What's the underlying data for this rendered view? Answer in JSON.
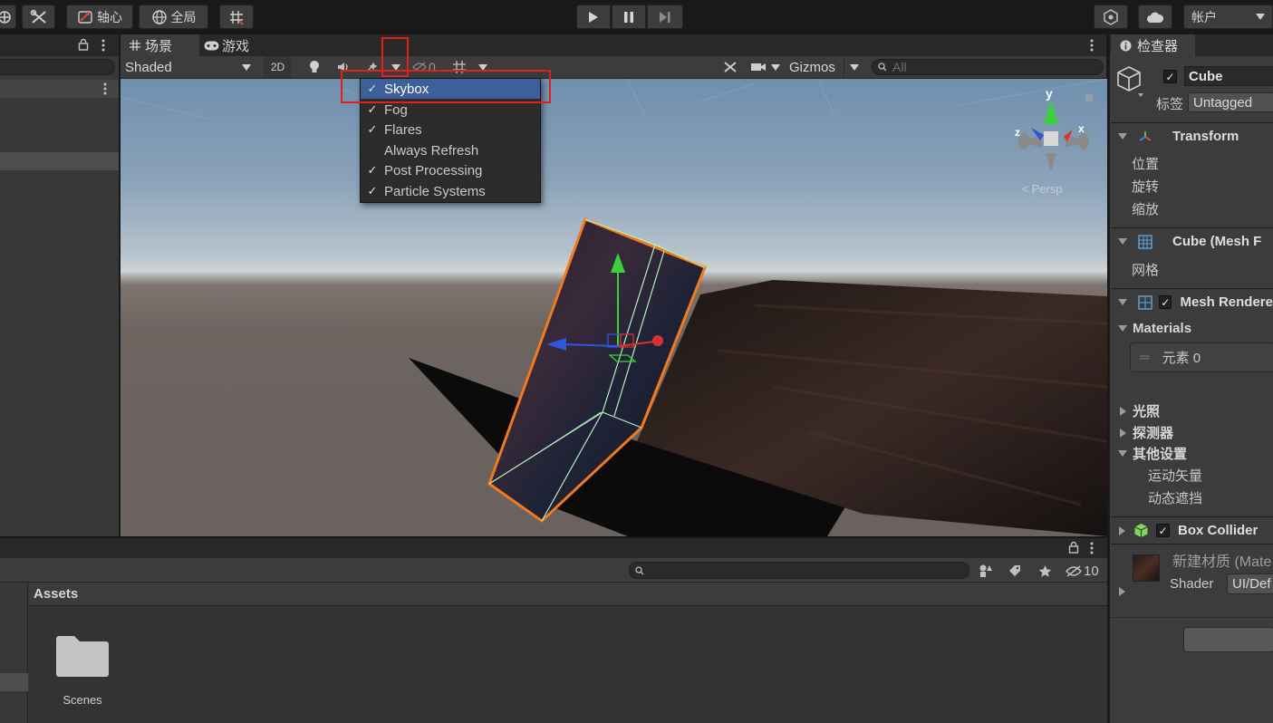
{
  "toolbar": {
    "pivot_label": "轴心",
    "global_label": "全局",
    "account_label": "帐户"
  },
  "scene_tabs": [
    {
      "label": "场景",
      "icon": "grid-icon"
    },
    {
      "label": "游戏",
      "icon": "gamepad-icon"
    }
  ],
  "scene_toolbar": {
    "shading_mode": "Shaded",
    "toggle_2d": "2D",
    "hidden_count": "0",
    "gizmos_label": "Gizmos",
    "search_placeholder": "All"
  },
  "effects_menu": {
    "items": [
      {
        "label": "Skybox",
        "checked": true,
        "highlighted": true
      },
      {
        "label": "Fog",
        "checked": true
      },
      {
        "label": "Flares",
        "checked": true
      },
      {
        "label": "Always Refresh",
        "checked": false
      },
      {
        "label": "Post Processing",
        "checked": true
      },
      {
        "label": "Particle Systems",
        "checked": true
      }
    ]
  },
  "scene_gizmo": {
    "y_axis": "y",
    "x_axis": "x",
    "z_axis": "z",
    "persp_label": "Persp"
  },
  "project": {
    "assets_header": "Assets",
    "hidden_count": "10",
    "folders": [
      {
        "name": "Scenes"
      }
    ]
  },
  "inspector": {
    "tab_label": "检查器",
    "object_name": "Cube",
    "tag_label": "标签",
    "tag_value": "Untagged",
    "transform": {
      "title": "Transform",
      "rows": [
        "位置",
        "旋转",
        "缩放"
      ]
    },
    "mesh_filter": {
      "title": "Cube (Mesh F",
      "mesh_label": "网格"
    },
    "mesh_renderer": {
      "title": "Mesh Rendere",
      "materials_label": "Materials",
      "element_label": "元素 0",
      "sections": [
        "光照",
        "探测器",
        "其他设置"
      ],
      "other_rows": [
        "运动矢量",
        "动态遮挡"
      ]
    },
    "box_collider": {
      "title": "Box Collider"
    },
    "material": {
      "name": "新建材质 (Mate",
      "shader_label": "Shader",
      "shader_value": "UI/Def"
    }
  },
  "colors": {
    "highlight_box": "#e02020",
    "selection_outline": "#f07a1e",
    "menu_highlight": "#3d5f9a",
    "sky_top": "#6f8fae",
    "ground": "#6d6460"
  }
}
